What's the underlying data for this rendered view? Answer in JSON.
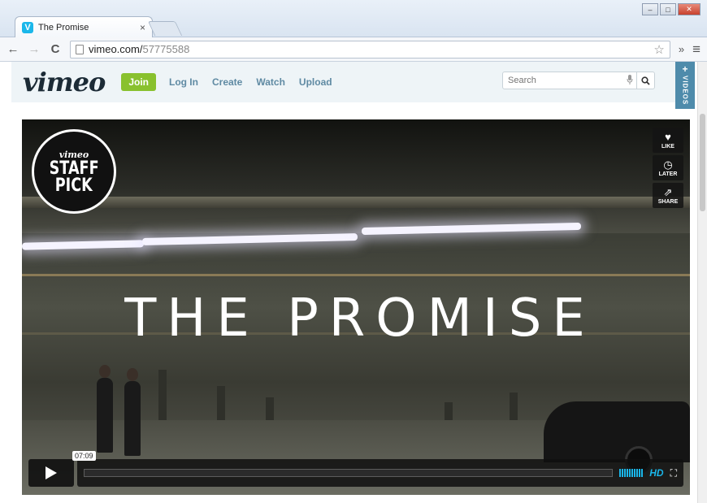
{
  "browser": {
    "tab_title": "The Promise",
    "tab_close": "×",
    "tab_favicon": "V",
    "url_host": "vimeo.com/",
    "url_path": "57775588",
    "back_icon": "←",
    "forward_icon": "→",
    "reload_icon": "C",
    "star_icon": "☆",
    "menu_icon": "≡",
    "ext_icon": "»"
  },
  "header": {
    "logo": "vimeo",
    "join": "Join",
    "nav": [
      "Log In",
      "Create",
      "Watch",
      "Upload"
    ],
    "search_placeholder": "Search",
    "videos_tab_plus": "+",
    "videos_tab": "VIDEOS"
  },
  "video": {
    "title": "THE PROMISE",
    "staff_pick_small": "vimeo",
    "staff_pick_line1": "STAFF",
    "staff_pick_line2": "PICK",
    "actions": [
      {
        "icon": "heart-icon",
        "glyph": "♥",
        "label": "LIKE"
      },
      {
        "icon": "clock-icon",
        "glyph": "◷",
        "label": "LATER"
      },
      {
        "icon": "share-icon",
        "glyph": "⇗",
        "label": "SHARE"
      }
    ],
    "duration": "07:09",
    "progress_percent": 0,
    "hd_label": "HD",
    "fullscreen_glyph": "⛶"
  },
  "colors": {
    "accent": "#1ab7ea",
    "join": "#89c12e",
    "nav_link": "#5f8aa3",
    "videos_tab": "#4e8bab"
  }
}
